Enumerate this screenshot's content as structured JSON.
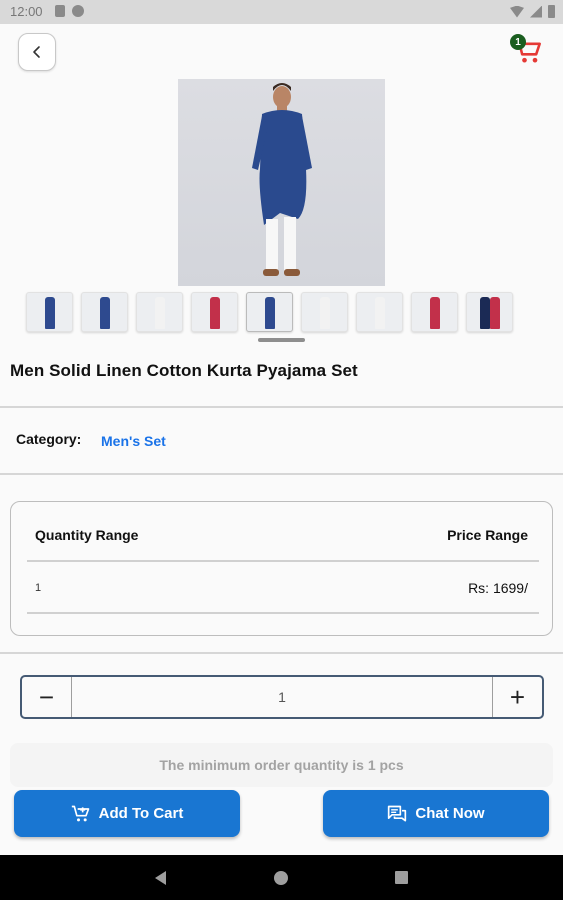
{
  "status_bar": {
    "time": "12:00"
  },
  "header": {
    "cart_count": "1"
  },
  "product": {
    "title": "Men Solid Linen Cotton Kurta Pyajama Set",
    "thumbnail_colors": [
      "#2e4a8f",
      "#2e4a8f",
      "#f2f2f2",
      "#c2304a",
      "#2e4a8f",
      "#f2f2f2",
      "#f2f2f2",
      "#c2304a",
      "#1b2a55"
    ]
  },
  "category": {
    "label": "Category:",
    "value": "Men's Set"
  },
  "pricing": {
    "quantity_header": "Quantity Range",
    "price_header": "Price Range",
    "rows": [
      {
        "quantity": "1",
        "price": "Rs: 1699/"
      }
    ]
  },
  "stepper": {
    "minus": "−",
    "value": "1",
    "plus": "+"
  },
  "min_order_text": "The minimum order quantity is 1 pcs",
  "actions": {
    "add_to_cart": "Add To Cart",
    "chat_now": "Chat Now"
  },
  "colors": {
    "accent": "#1976d2",
    "link": "#1a73e8",
    "badge": "#1b5e20",
    "cart_icon": "#e53935"
  }
}
